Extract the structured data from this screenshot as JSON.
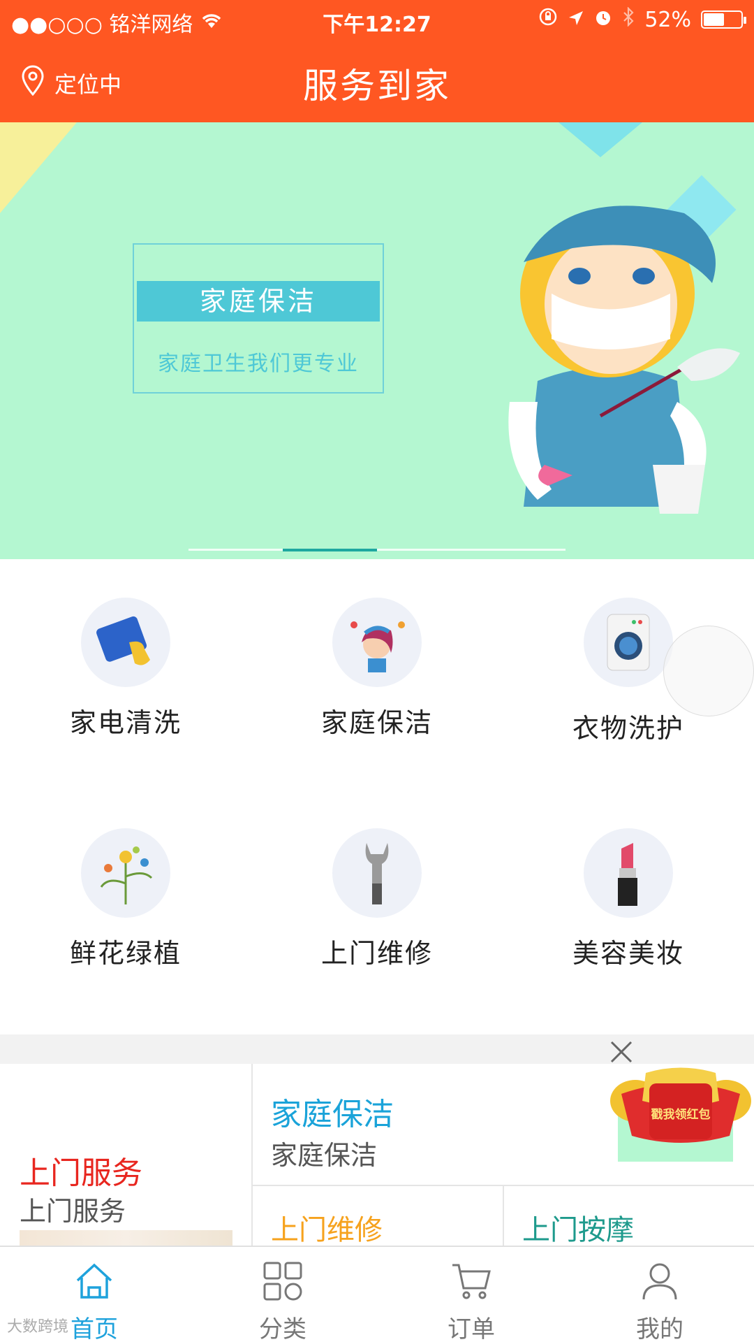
{
  "status_bar": {
    "carrier": "●●○○○ 铭洋网络",
    "time": "下午12:27",
    "battery": "52%"
  },
  "header": {
    "location": "定位中",
    "title": "服务到家"
  },
  "banner": {
    "heading": "家庭保洁",
    "slogan": "家庭卫生我们更专业",
    "active_dot": 2,
    "dot_count": 4
  },
  "categories": [
    {
      "label": "家电清洗",
      "icon": "sponge-icon"
    },
    {
      "label": "家庭保洁",
      "icon": "cleaning-lady-icon"
    },
    {
      "label": "衣物洗护",
      "icon": "washing-machine-icon"
    },
    {
      "label": "鲜花绿植",
      "icon": "flowers-icon"
    },
    {
      "label": "上门维修",
      "icon": "wrench-icon"
    },
    {
      "label": "美容美妆",
      "icon": "lipstick-icon"
    }
  ],
  "services": {
    "left": {
      "title": "上门服务",
      "subtitle": "上门服务"
    },
    "top": {
      "title": "家庭保洁",
      "subtitle": "家庭保洁"
    },
    "bottom_left": {
      "title": "上门维修"
    },
    "bottom_right": {
      "title": "上门按摩"
    }
  },
  "red_packet": {
    "label": "戳我领红包"
  },
  "tabbar": [
    {
      "label": "首页",
      "icon": "home-icon",
      "active": true
    },
    {
      "label": "分类",
      "icon": "grid-icon",
      "active": false
    },
    {
      "label": "订单",
      "icon": "cart-icon",
      "active": false
    },
    {
      "label": "我的",
      "icon": "person-icon",
      "active": false
    }
  ],
  "watermark": "大数跨境",
  "colors": {
    "brand_orange": "#ff5722",
    "banner_bg": "#b4f7d1",
    "accent_blue": "#1ea2dc",
    "service_red": "#e8261f",
    "service_yellow": "#f6a21d",
    "service_teal": "#1e9a8c"
  }
}
